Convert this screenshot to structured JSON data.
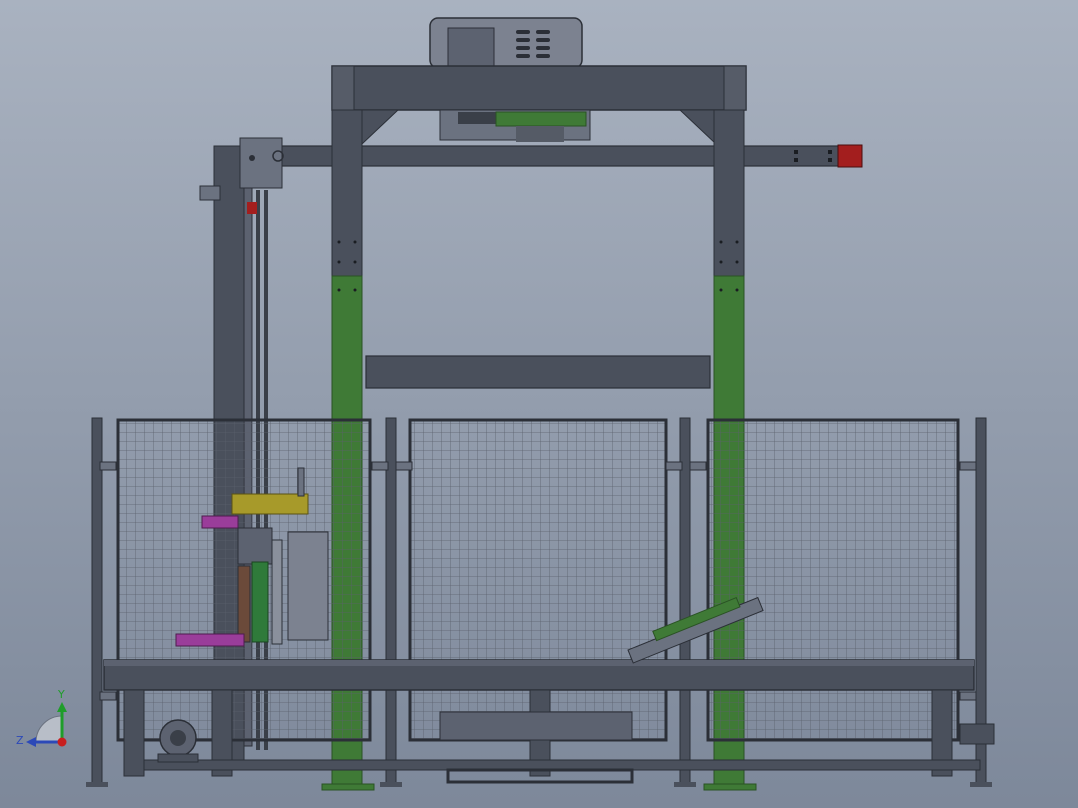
{
  "viewport": {
    "background_top": "#a9b2c0",
    "background_bottom": "#7d889a"
  },
  "colors": {
    "steel": "#4a505c",
    "steel_dark": "#2b2f37",
    "steel_light": "#6b7280",
    "column_green": "#3f7a36",
    "column_green_dark": "#2a5224",
    "mesh": "#5a606c",
    "red_block": "#a31e1e",
    "yellow_block": "#a79a2a",
    "magenta_block": "#9a3d9a",
    "green_roll": "#2f7a3a",
    "motor_housing": "#7c8290"
  },
  "triad": {
    "y_label": "Y",
    "z_label": "Z",
    "y_color": "#1f9d2a",
    "z_color": "#2c49b8",
    "x_color": "#c81f1f"
  }
}
